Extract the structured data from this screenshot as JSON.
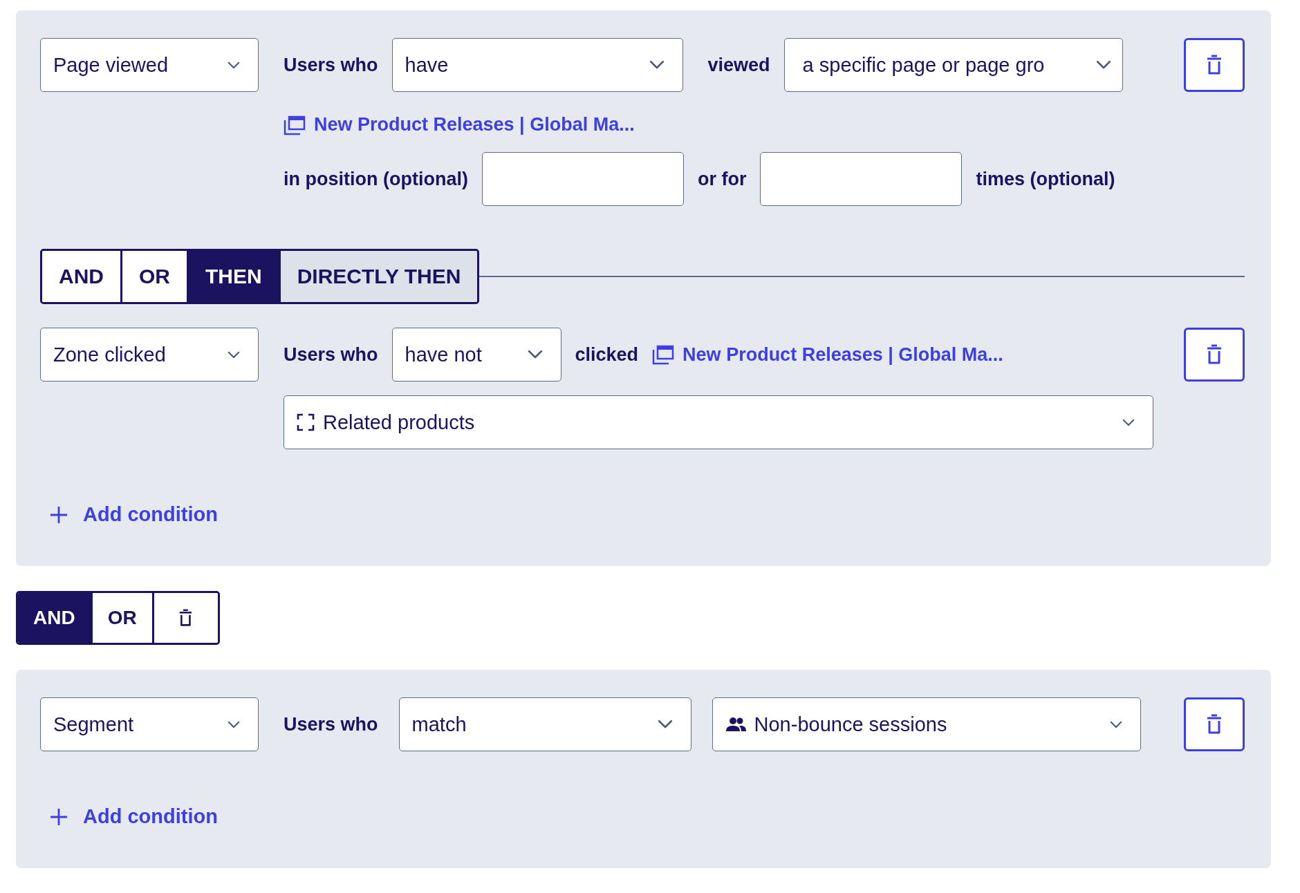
{
  "groups": [
    {
      "kind": "panel",
      "conditions": [
        {
          "kind": "page",
          "type": "Page viewed",
          "users_label": "Users who",
          "verb": "have",
          "verb_label": "viewed",
          "target": "a specific page or page gro",
          "link": "New Product Releases | Global Ma...",
          "position_label": "in position (optional)",
          "or_label": "or for",
          "times_label": "times (optional)"
        },
        {
          "kind": "operator",
          "options": [
            {
              "label": "AND",
              "selected": false,
              "highlighted": false
            },
            {
              "label": "OR",
              "selected": false,
              "highlighted": false
            },
            {
              "label": "THEN",
              "selected": true,
              "highlighted": false
            },
            {
              "label": "DIRECTLY THEN",
              "selected": false,
              "highlighted": true
            }
          ]
        },
        {
          "kind": "zone",
          "type": "Zone clicked",
          "users_label": "Users who",
          "verb": "have not",
          "verb_label": "clicked",
          "link": "New Product Releases | Global Ma...",
          "zone": "Related products"
        }
      ],
      "add_condition": "Add condition"
    },
    {
      "kind": "joiner",
      "options": [
        {
          "label": "AND",
          "selected": true
        },
        {
          "label": "OR",
          "selected": false
        }
      ]
    },
    {
      "kind": "panel",
      "conditions": [
        {
          "kind": "segment",
          "type": "Segment",
          "users_label": "Users who",
          "verb": "match",
          "segment": "Non-bounce sessions"
        }
      ],
      "add_condition": "Add condition"
    }
  ]
}
